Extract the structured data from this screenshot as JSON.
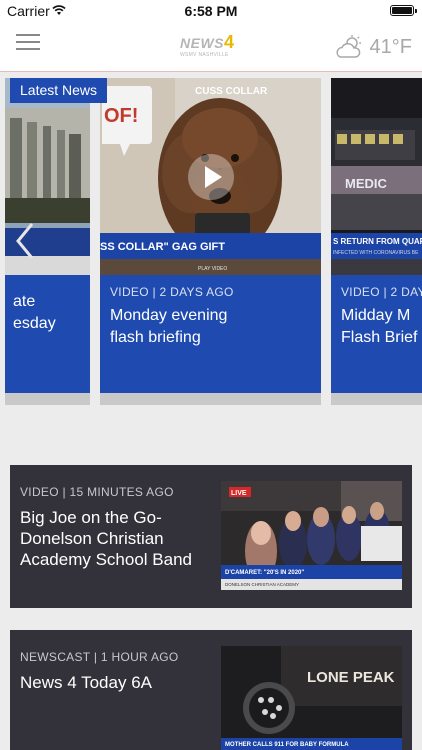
{
  "status_bar": {
    "carrier": "Carrier",
    "time": "6:58 PM",
    "battery_level": 1.0
  },
  "nav": {
    "logo": {
      "text": "NEWS",
      "four": "4",
      "sub": "WSMV NASHVILLE"
    },
    "weather": {
      "icon": "cloud-sun-icon",
      "temp": "41°F"
    }
  },
  "carousel": {
    "badge": "Latest News",
    "cards": [
      {
        "meta": "",
        "title_line1": "ate",
        "title_line2": "esday"
      },
      {
        "meta": "VIDEO | 2 DAYS AGO",
        "title_line1": "Monday evening",
        "title_line2": "flash briefing",
        "image_header": "CUSS COLLAR",
        "image_bubble": "OF!",
        "image_ticker": "SS COLLAR\" GAG GIFT",
        "image_caption": "PLAY VIDEO"
      },
      {
        "meta": "VIDEO | 2 DAYS AGO",
        "title_line1": "Midday M",
        "title_line2": "Flash Brief",
        "image_sign": "MEDIC",
        "image_ticker": "S RETURN FROM QUAR",
        "image_ticker_sub": "INFECTED WITH CORONAVIRUS BE"
      }
    ]
  },
  "stories": [
    {
      "meta": "VIDEO | 15 MINUTES AGO",
      "title": "Big Joe on the Go- Donelson Christian Academy School Band",
      "thumb_live": "LIVE",
      "thumb_ticker": "D'CAMARET: \"20'S IN 2020\"",
      "thumb_ticker_sub": "DONELSON CHRISTIAN ACADEMY"
    },
    {
      "meta": "NEWSCAST | 1 HOUR AGO",
      "title": "News 4 Today 6A",
      "thumb_sign": "LONE PEAK",
      "thumb_ticker": "MOTHER CALLS 911 FOR BABY FORMULA"
    }
  ],
  "colors": {
    "brand_blue": "#1f4bb0",
    "story_bg": "#33313a",
    "page_bg": "#ececec"
  }
}
